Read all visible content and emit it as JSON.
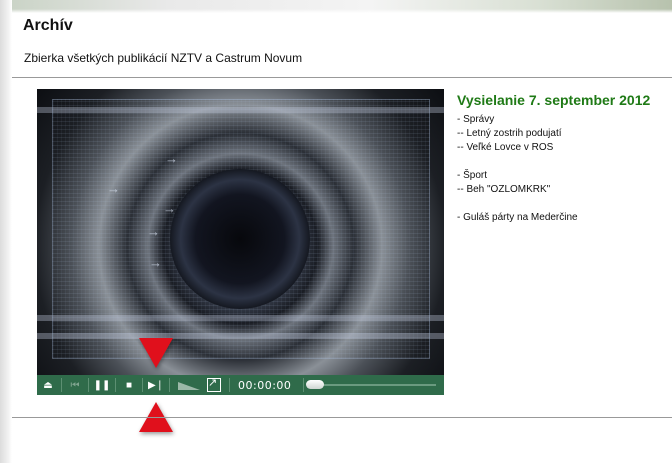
{
  "header": {
    "title": "Archív",
    "subtitle": "Zbierka všetkých publikácií NZTV a Castrum Novum"
  },
  "player": {
    "time": "00:00:00",
    "progress": 0,
    "controls": [
      "eject-icon",
      "skip-back-icon",
      "pause-icon",
      "stop-icon",
      "next-icon",
      "volume-icon",
      "fullscreen-icon"
    ]
  },
  "broadcast": {
    "title": "Vysielanie 7. september 2012",
    "items": [
      "- Správy",
      "-- Letný zostrih podujatí",
      "-- Veľké Lovce v ROS",
      "",
      "- Šport",
      "-- Beh \"OZLOMKRK\"",
      "",
      "- Guláš párty na Mederčine"
    ]
  },
  "colors": {
    "accent_green": "#1f7a16",
    "controlbar": "#2f6b4a",
    "marker_red": "#e0101c"
  }
}
